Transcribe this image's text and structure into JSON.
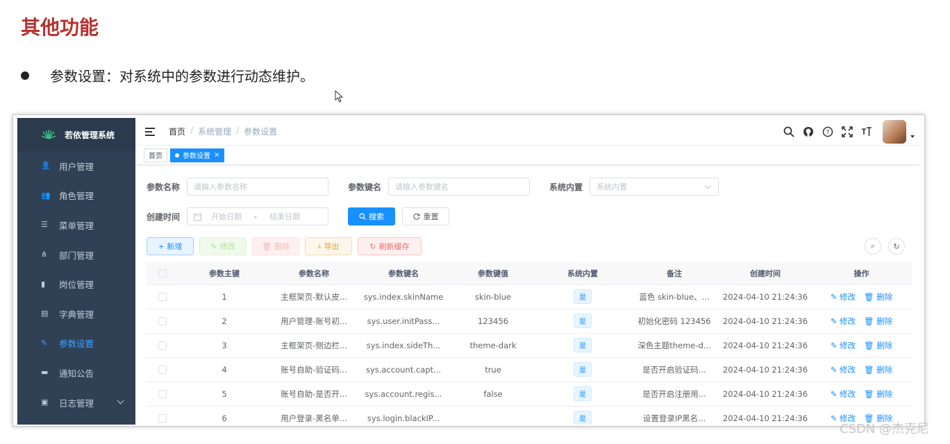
{
  "slide": {
    "title": "其他功能",
    "bullet": "参数设置：对系统中的参数进行动态维护。",
    "watermark": "CSDN @杰克尼"
  },
  "app": {
    "name": "若依管理系统"
  },
  "sidebar": {
    "items": [
      {
        "label": "用户管理",
        "icon": "user-icon"
      },
      {
        "label": "角色管理",
        "icon": "role-icon"
      },
      {
        "label": "菜单管理",
        "icon": "menu-list-icon"
      },
      {
        "label": "部门管理",
        "icon": "tree-icon"
      },
      {
        "label": "岗位管理",
        "icon": "post-icon"
      },
      {
        "label": "字典管理",
        "icon": "dict-icon"
      },
      {
        "label": "参数设置",
        "icon": "edit-icon",
        "active": true
      },
      {
        "label": "通知公告",
        "icon": "message-icon"
      },
      {
        "label": "日志管理",
        "icon": "log-icon"
      }
    ]
  },
  "breadcrumb": [
    "首页",
    "系统管理",
    "参数设置"
  ],
  "tags": [
    {
      "label": "首页"
    },
    {
      "label": "参数设置",
      "active": true,
      "close": "×"
    }
  ],
  "search_form": {
    "config_name_label": "参数名称",
    "config_name_placeholder": "请输入参数名称",
    "config_key_label": "参数键名",
    "config_key_placeholder": "请输入参数键名",
    "builtin_label": "系统内置",
    "builtin_placeholder": "系统内置",
    "create_time_label": "创建时间",
    "start_date_placeholder": "开始日期",
    "date_sep": "-",
    "end_date_placeholder": "结束日期",
    "search_label": "搜索",
    "reset_label": "重置"
  },
  "toolbar": {
    "add_label": "+ 新增",
    "edit_label": "修改",
    "delete_label": "删除",
    "export_label": "导出",
    "refresh_cache_label": "刷新缓存"
  },
  "table": {
    "headers": [
      "参数主键",
      "参数名称",
      "参数键名",
      "参数键值",
      "系统内置",
      "备注",
      "创建时间",
      "操作"
    ],
    "rows": [
      {
        "id": "1",
        "name": "主框架页-默认皮...",
        "key": "sys.index.skinName",
        "value": "skin-blue",
        "builtin": "是",
        "remark": "蓝色 skin-blue、...",
        "time": "2024-04-10 21:24:36"
      },
      {
        "id": "2",
        "name": "用户管理-账号初...",
        "key": "sys.user.initPass...",
        "value": "123456",
        "builtin": "是",
        "remark": "初始化密码 123456",
        "time": "2024-04-10 21:24:36"
      },
      {
        "id": "3",
        "name": "主框架页-侧边栏...",
        "key": "sys.index.sideTh...",
        "value": "theme-dark",
        "builtin": "是",
        "remark": "深色主题theme-d...",
        "time": "2024-04-10 21:24:36"
      },
      {
        "id": "4",
        "name": "账号自助-验证码...",
        "key": "sys.account.capt...",
        "value": "true",
        "builtin": "是",
        "remark": "是否开启验证码...",
        "time": "2024-04-10 21:24:36"
      },
      {
        "id": "5",
        "name": "账号自助-是否开...",
        "key": "sys.account.regis...",
        "value": "false",
        "builtin": "是",
        "remark": "是否开启注册用...",
        "time": "2024-04-10 21:24:36"
      },
      {
        "id": "6",
        "name": "用户登录-黑名单...",
        "key": "sys.login.blackIP...",
        "value": "",
        "builtin": "是",
        "remark": "设置登录IP黑名...",
        "time": "2024-04-10 21:24:36"
      }
    ],
    "op_edit": "修改",
    "op_delete": "删除"
  }
}
